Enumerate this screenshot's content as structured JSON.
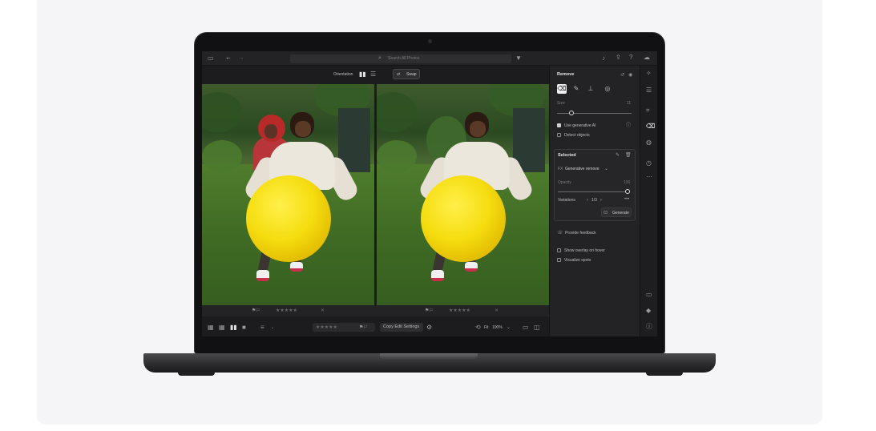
{
  "toolbar": {
    "search_placeholder": "Search All Photos"
  },
  "view": {
    "orientation_label": "Orientation",
    "swap_label": "Swap"
  },
  "panel": {
    "title": "Remove",
    "size_label": "Size",
    "size_value": "11",
    "use_generative_ai": "Use generative AI",
    "use_generative_ai_checked": true,
    "detect_objects": "Detect objects",
    "detect_objects_checked": false,
    "selected_title": "Selected",
    "selected_prefix": "FX",
    "mode_select": "Generative remove",
    "opacity_label": "Opacity",
    "opacity_value": "100",
    "variations_label": "Variations",
    "variations_value": "1/3",
    "generate_label": "Generate",
    "feedback_label": "Provide feedback",
    "show_overlay": "Show overlay on hover",
    "visualize_spots": "Visualize spots"
  },
  "bottom": {
    "copy_settings": "Copy Edit Settings",
    "fit_label": "Fit",
    "zoom": "100%"
  },
  "colors": {
    "app_bg": "#1c1c1e",
    "panel_bg": "#232325",
    "laptop_body": "#2a2a2c"
  }
}
